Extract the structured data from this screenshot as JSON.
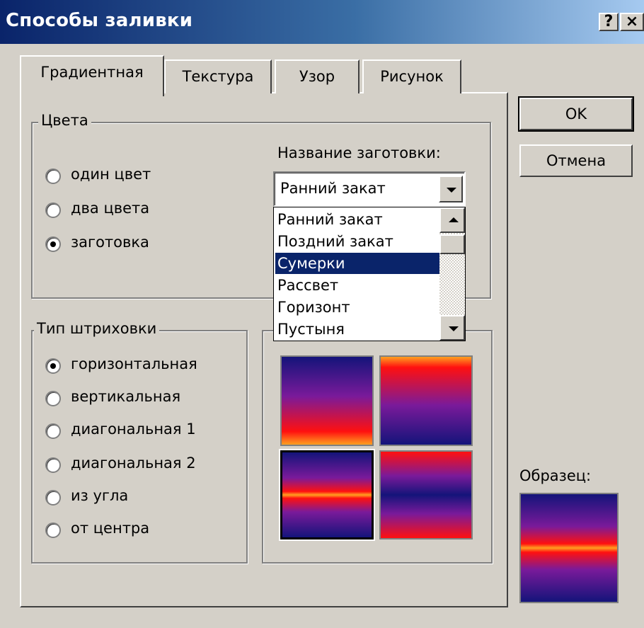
{
  "dialog": {
    "title": "Способы заливки",
    "help_button": "?",
    "close_button": "×"
  },
  "tabs": [
    {
      "label": "Градиентная",
      "active": true
    },
    {
      "label": "Текстура",
      "active": false
    },
    {
      "label": "Узор",
      "active": false
    },
    {
      "label": "Рисунок",
      "active": false
    }
  ],
  "colors_group": {
    "legend": "Цвета",
    "options": [
      {
        "label": "один цвет",
        "checked": false
      },
      {
        "label": "два цвета",
        "checked": false
      },
      {
        "label": "заготовка",
        "checked": true
      }
    ],
    "preset_label": "Название заготовки:",
    "preset_value": "Ранний закат",
    "preset_list": [
      {
        "label": "Ранний закат",
        "selected": false
      },
      {
        "label": "Поздний закат",
        "selected": false
      },
      {
        "label": "Сумерки",
        "selected": true
      },
      {
        "label": "Рассвет",
        "selected": false
      },
      {
        "label": "Горизонт",
        "selected": false
      },
      {
        "label": "Пустыня",
        "selected": false
      }
    ]
  },
  "shading_group": {
    "legend": "Тип штриховки",
    "options": [
      {
        "label": "горизонтальная",
        "checked": true
      },
      {
        "label": "вертикальная",
        "checked": false
      },
      {
        "label": "диагональная 1",
        "checked": false
      },
      {
        "label": "диагональная 2",
        "checked": false
      },
      {
        "label": "из угла",
        "checked": false
      },
      {
        "label": "от центра",
        "checked": false
      }
    ]
  },
  "buttons": {
    "ok": "OK",
    "cancel": "Отмена"
  },
  "sample": {
    "label": "Образец:"
  },
  "colors": {
    "title_bar_start": "#0a246a",
    "selection": "#0a246a",
    "gradient_navy": "#14147a",
    "gradient_purple": "#7a1a9a",
    "gradient_red": "#ff1010",
    "gradient_orange": "#ffa020"
  }
}
